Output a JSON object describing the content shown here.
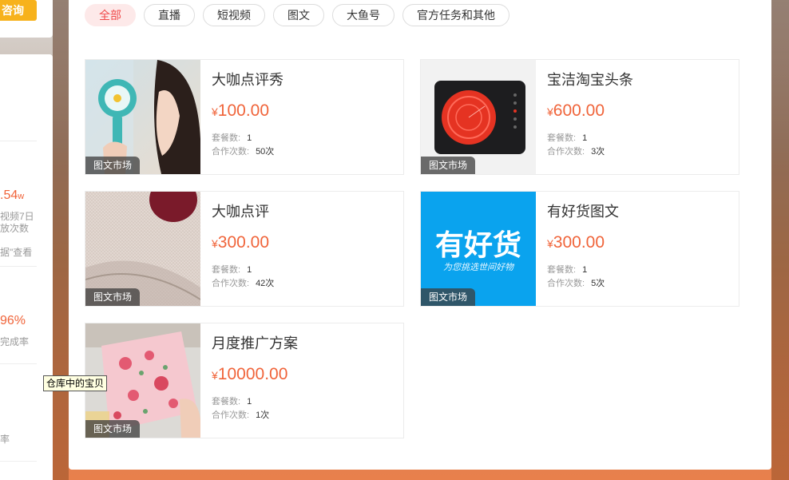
{
  "sidebar": {
    "consult_label": "咨询",
    "stat1_value": ".54",
    "stat1_unit": "w",
    "stat1_desc1": "视频7日",
    "stat1_desc2": "放次数",
    "stat1_hint": "据\"查看",
    "stat2_value": "96%",
    "stat2_desc": "完成率",
    "stat3_desc": "率"
  },
  "tabs": [
    {
      "label": "全部",
      "active": true
    },
    {
      "label": "直播",
      "active": false
    },
    {
      "label": "短视频",
      "active": false
    },
    {
      "label": "图文",
      "active": false
    },
    {
      "label": "大鱼号",
      "active": false
    },
    {
      "label": "官方任务和其他",
      "active": false
    }
  ],
  "cards": [
    {
      "title": "大咖点评秀",
      "currency": "¥",
      "price": "100.00",
      "badge": "图文市场",
      "packages_label": "套餐数:",
      "packages": "1",
      "coop_label": "合作次数:",
      "coop": "50次",
      "image": "hand-fan-photo"
    },
    {
      "title": "宝洁淘宝头条",
      "currency": "¥",
      "price": "600.00",
      "badge": "图文市场",
      "packages_label": "套餐数:",
      "packages": "1",
      "coop_label": "合作次数:",
      "coop": "3次",
      "image": "induction-cooker-photo"
    },
    {
      "title": "大咖点评",
      "currency": "¥",
      "price": "300.00",
      "badge": "图文市场",
      "packages_label": "套餐数:",
      "packages": "1",
      "coop_label": "合作次数:",
      "coop": "42次",
      "image": "knit-fabric-photo"
    },
    {
      "title": "有好货图文",
      "currency": "¥",
      "price": "300.00",
      "badge": "图文市场",
      "packages_label": "套餐数:",
      "packages": "1",
      "coop_label": "合作次数:",
      "coop": "5次",
      "image": "youhaohuo-logo",
      "logo_text": "有好货",
      "logo_sub": "为您挑选世间好物"
    },
    {
      "title": "月度推广方案",
      "currency": "¥",
      "price": "10000.00",
      "badge": "图文市场",
      "packages_label": "套餐数:",
      "packages": "1",
      "coop_label": "合作次数:",
      "coop": "1次",
      "image": "floral-pouch-photo"
    }
  ],
  "tooltip": "仓库中的宝贝",
  "colors": {
    "accent": "#f0643a",
    "active_tab_bg": "#fde9e9",
    "active_tab_text": "#f04a4a",
    "consult_btn": "#f7b21c",
    "logo_bg": "#0aa3ee"
  }
}
